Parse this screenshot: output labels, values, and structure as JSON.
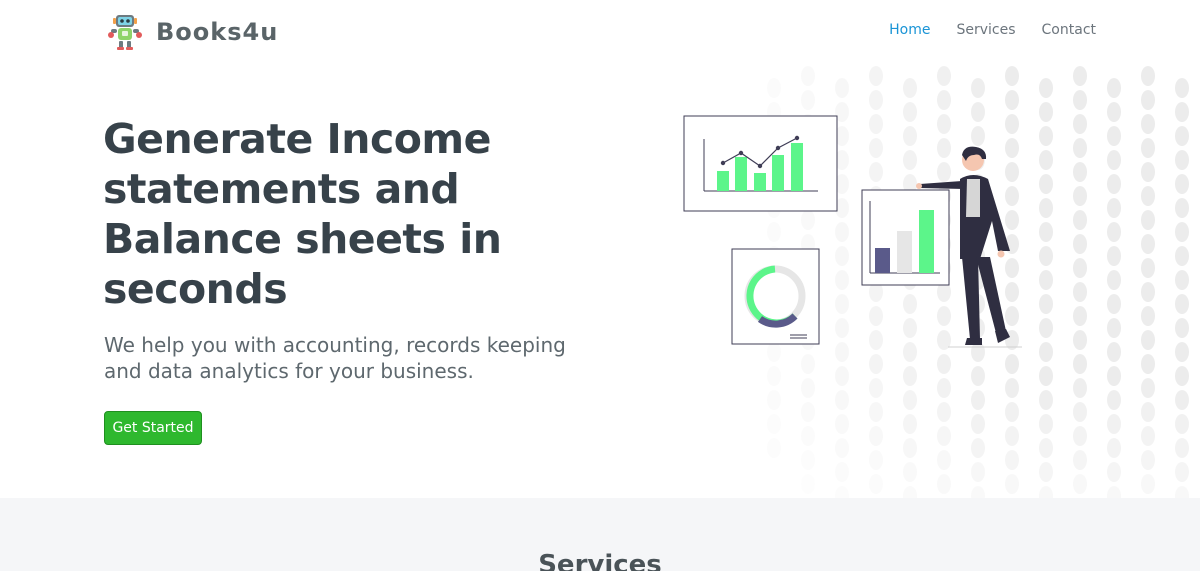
{
  "brand": {
    "name": "Books4u",
    "logo_icon": "robot-icon"
  },
  "nav": {
    "items": [
      {
        "label": "Home",
        "active": true
      },
      {
        "label": "Services",
        "active": false
      },
      {
        "label": "Contact",
        "active": false
      }
    ]
  },
  "hero": {
    "title": "Generate Income statements and Balance sheets in seconds",
    "subtitle": "We help you with accounting, records keeping and data analytics for your business.",
    "cta_label": "Get Started"
  },
  "services": {
    "title": "Services"
  },
  "colors": {
    "accent": "#1a94d6",
    "cta": "#2eb82e",
    "chart_green": "#5cf58a",
    "chart_purple": "#5a5a8a"
  }
}
